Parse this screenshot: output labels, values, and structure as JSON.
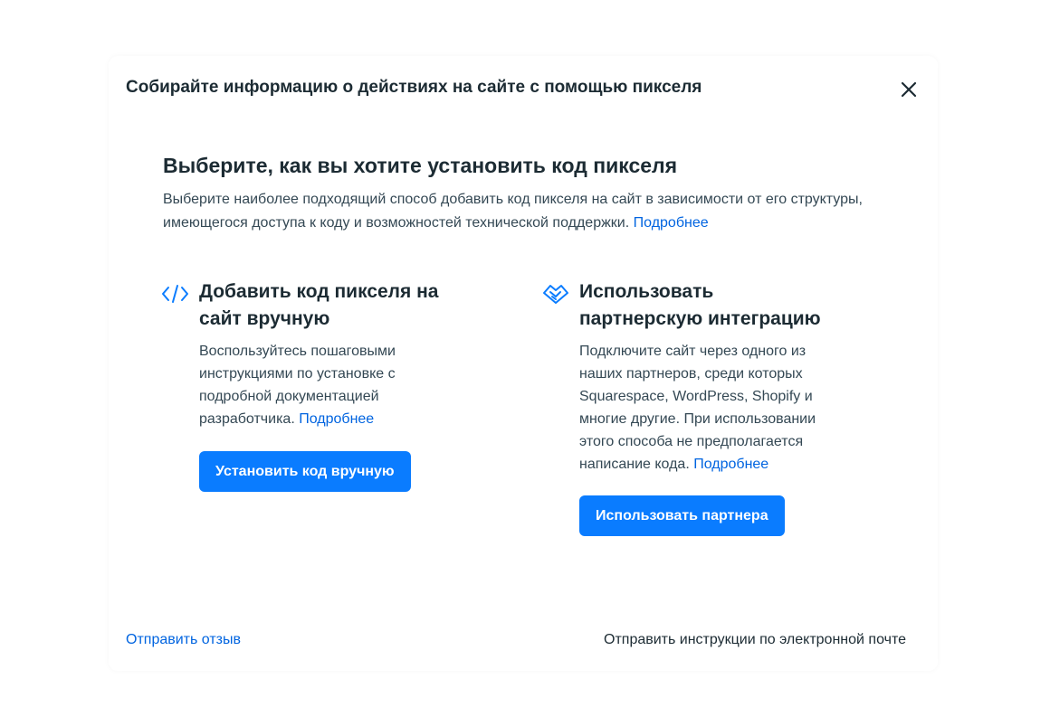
{
  "dialog": {
    "title": "Собирайте информацию о действиях на сайте с помощью пикселя",
    "close_icon": "close-icon"
  },
  "main": {
    "heading": "Выберите, как вы хотите установить код пикселя",
    "description": "Выберите наиболее подходящий способ добавить код пикселя на сайт в зависимости от его структуры, имеющегося доступа к коду и возможностей технической поддержки.",
    "more_link": "Подробнее"
  },
  "options": [
    {
      "icon": "code-icon",
      "title": "Добавить код пикселя на сайт вручную",
      "description": "Воспользуйтесь пошаговыми инструкциями по установке с подробной документацией разработчика.",
      "more_link": "Подробнее",
      "button_label": "Установить код вручную"
    },
    {
      "icon": "handshake-icon",
      "title": "Использовать партнерскую интеграцию",
      "description": "Подключите сайт через одного из наших партнеров, среди которых Squarespace, WordPress, Shopify и многие другие. При использовании этого способа не предполагается написание кода.",
      "more_link": "Подробнее",
      "button_label": "Использовать партнера"
    }
  ],
  "footer": {
    "feedback_link": "Отправить отзыв",
    "email_instructions": "Отправить инструкции по электронной почте"
  },
  "colors": {
    "accent": "#0a7cff",
    "link": "#0064e0",
    "text": "#1c2b33"
  }
}
